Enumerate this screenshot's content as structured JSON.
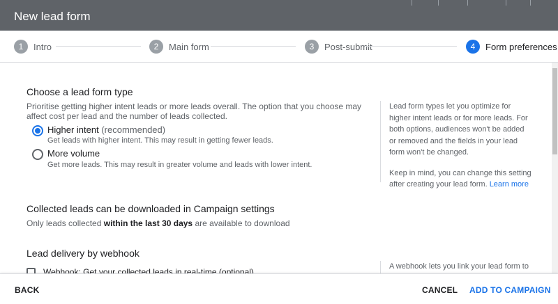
{
  "dialog": {
    "title": "New lead form"
  },
  "stepper": {
    "steps": [
      {
        "number": "1",
        "label": "Intro"
      },
      {
        "number": "2",
        "label": "Main form"
      },
      {
        "number": "3",
        "label": "Post-submit"
      },
      {
        "number": "4",
        "label": "Form preferences"
      }
    ],
    "active_step": 4
  },
  "lead_form_type": {
    "heading": "Choose a lead form type",
    "description": "Prioritise getting higher intent leads or more leads overall. The option that you choose may affect cost per lead and the number of leads collected.",
    "options": [
      {
        "label": "Higher intent",
        "tag": "(recommended)",
        "description": "Get leads with higher intent. This may result in getting fewer leads.",
        "selected": true
      },
      {
        "label": "More volume",
        "tag": "",
        "description": "Get more leads. This may result in greater volume and leads with lower intent.",
        "selected": false
      }
    ],
    "side_note": "Lead form types let you optimize for higher intent leads or for more leads. For both options, audiences won't be added or removed and the fields in your lead form won't be changed.",
    "side_note_2": "Keep in mind, you can change this setting after creating your lead form.",
    "learn_more": "Learn more"
  },
  "collected_leads": {
    "heading": "Collected leads can be downloaded in Campaign settings",
    "text_before": "Only leads collected ",
    "text_bold": "within the last 30 days",
    "text_after": " are available to download"
  },
  "webhook": {
    "heading": "Lead delivery by webhook",
    "checkbox_label": "Webhook: Get your collected leads in real-time (optional)",
    "checked": false,
    "side_note": "A webhook lets you link your lead form to"
  },
  "footer": {
    "back_label": "BACK",
    "cancel_label": "CANCEL",
    "add_label": "ADD TO CAMPAIGN"
  },
  "colors": {
    "accent": "#1a73e8",
    "title_bar": "#5f6368",
    "muted_text": "#5f6368"
  }
}
